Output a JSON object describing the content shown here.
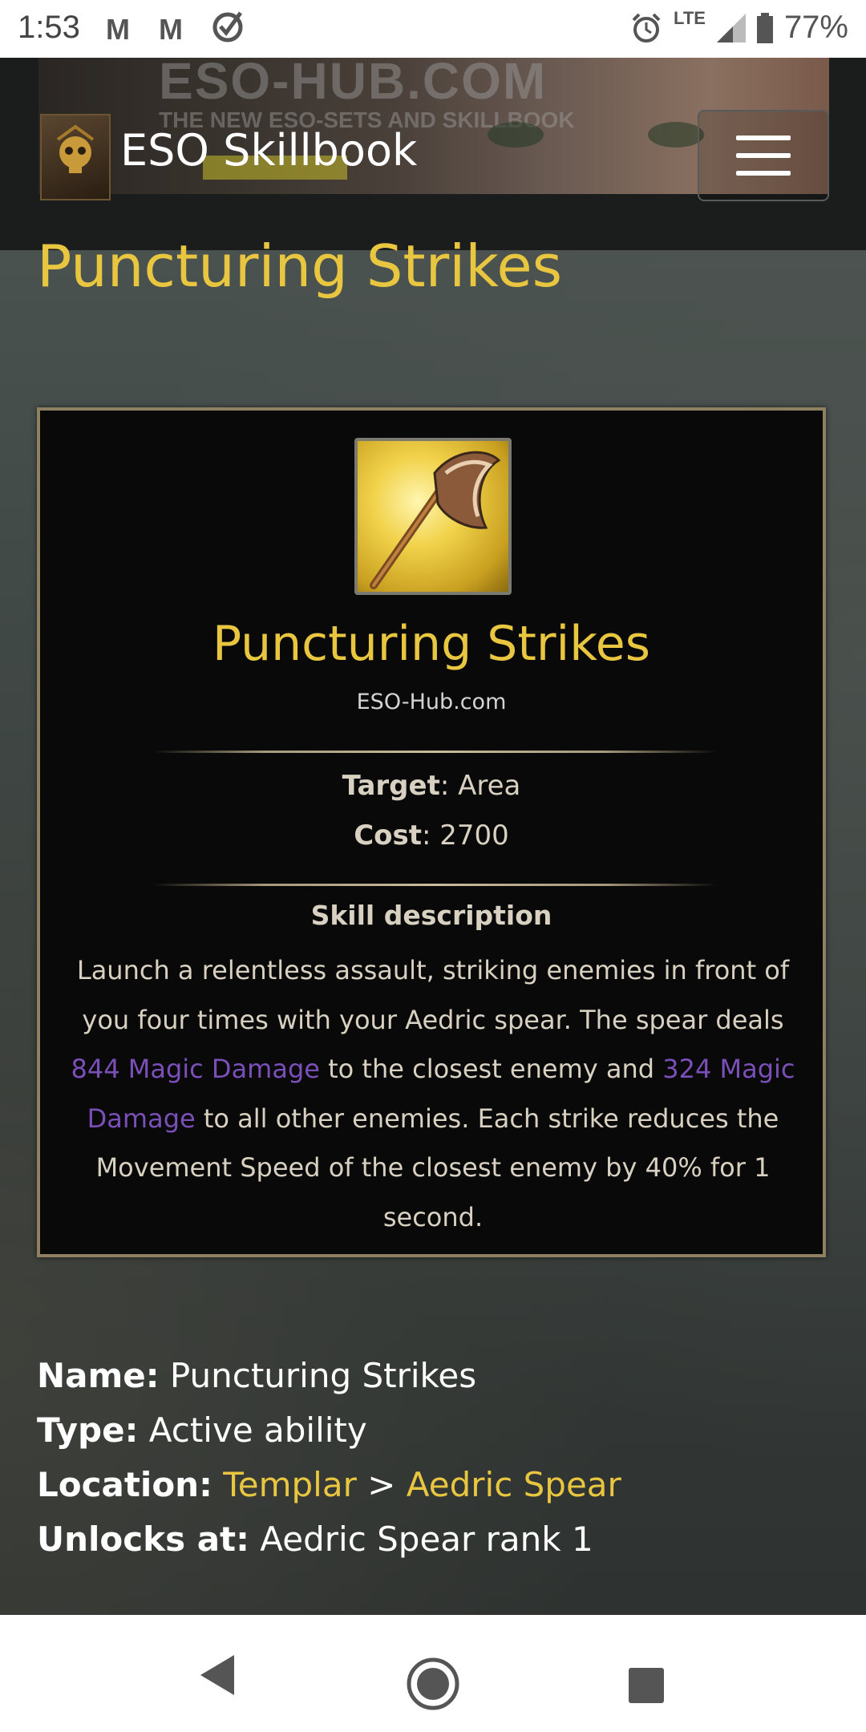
{
  "status_bar": {
    "time": "1:53",
    "network": "LTE",
    "battery": "77%",
    "icons": [
      "gmail-icon",
      "gmail-icon",
      "check-circle-icon",
      "alarm-icon",
      "signal-icon",
      "battery-icon"
    ]
  },
  "header": {
    "brand": "ESO Skillbook",
    "banner_text": "ESO-HUB.COM",
    "banner_subtext": "THE NEW ESO-SETS AND SKILLBOOK",
    "menu_icon": "hamburger-menu-icon"
  },
  "page": {
    "title": "Puncturing Strikes"
  },
  "card": {
    "icon": "axe-skill-icon",
    "title": "Puncturing Strikes",
    "site": "ESO-Hub.com",
    "target_label": "Target",
    "target_value": ": Area",
    "cost_label": "Cost",
    "cost_value": ": 2700",
    "description_heading": "Skill description",
    "desc_1": "Launch a relentless assault, striking enemies in front of you four times with your Aedric spear. The spear deals ",
    "desc_magic_1": "844 Magic Damage",
    "desc_2": " to the closest enemy and ",
    "desc_magic_2": "324 Magic Damage",
    "desc_3": " to all other enemies. Each strike reduces the Movement Speed of the closest enemy by 40% for 1 second."
  },
  "info": {
    "name_label": "Name:",
    "name_value": " Puncturing Strikes",
    "type_label": "Type:",
    "type_value": " Active ability",
    "location_label": "Location:",
    "location_link_1": "Templar",
    "location_sep": " > ",
    "location_link_2": "Aedric Spear",
    "unlocks_label": "Unlocks at:",
    "unlocks_value": " Aedric Spear rank 1"
  },
  "nav_bar": {
    "icons": [
      "back-icon",
      "home-icon",
      "recents-icon"
    ]
  }
}
